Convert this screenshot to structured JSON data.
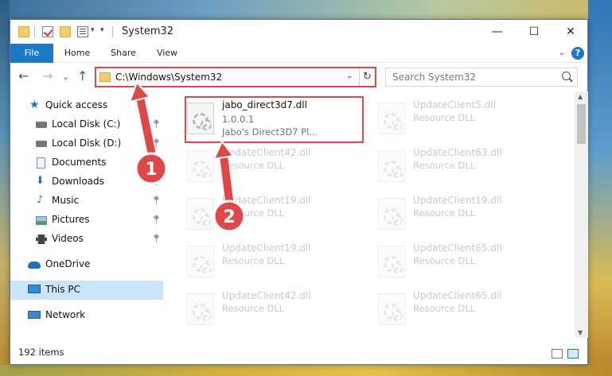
{
  "window": {
    "title": "System32",
    "controls": {
      "minimize": "—",
      "maximize": "☐",
      "close": "✕"
    }
  },
  "ribbon": {
    "tabs": [
      "File",
      "Home",
      "Share",
      "View"
    ],
    "help": "?"
  },
  "nav": {
    "back": "←",
    "forward": "→",
    "recent": "⌄",
    "up": "↑",
    "address": "C:\\Windows\\System32",
    "refresh": "↻",
    "search_placeholder": "Search System32"
  },
  "sidebar": {
    "items": [
      {
        "label": "Quick access",
        "icon": "star-icon",
        "pinned": false
      },
      {
        "label": "Local Disk (C:)",
        "icon": "drive-icon",
        "pinned": true
      },
      {
        "label": "Local Disk (D:)",
        "icon": "drive-icon",
        "pinned": true
      },
      {
        "label": "Documents",
        "icon": "documents-icon",
        "pinned": true
      },
      {
        "label": "Downloads",
        "icon": "downloads-icon",
        "pinned": true
      },
      {
        "label": "Music",
        "icon": "music-icon",
        "pinned": true
      },
      {
        "label": "Pictures",
        "icon": "pictures-icon",
        "pinned": true
      },
      {
        "label": "Videos",
        "icon": "videos-icon",
        "pinned": true
      },
      {
        "label": "OneDrive",
        "icon": "onedrive-icon",
        "pinned": false
      },
      {
        "label": "This PC",
        "icon": "computer-icon",
        "pinned": false,
        "selected": true
      },
      {
        "label": "Network",
        "icon": "network-icon",
        "pinned": false
      }
    ]
  },
  "files": [
    {
      "name": "jabo_direct3d7.dll",
      "line2": "1.0.0.1",
      "line3": "Jabo's Direct3D7 Pl...",
      "faded": false
    },
    {
      "name": "UpdateClient5.dll",
      "line2": "Resource DLL",
      "faded": true
    },
    {
      "name": "UpdateClient42.dll",
      "line2": "Resource DLL",
      "faded": true
    },
    {
      "name": "UpdateClient63.dll",
      "line2": "Resource DLL",
      "faded": true
    },
    {
      "name": "UpdateClient19.dll",
      "line2": "Resource DLL",
      "faded": true
    },
    {
      "name": "UpdateClient19.dll",
      "line2": "Resource DLL",
      "faded": true
    },
    {
      "name": "UpdateClient19.dll",
      "line2": "Resource DLL",
      "faded": true
    },
    {
      "name": "UpdateClient65.dll",
      "line2": "Resource DLL",
      "faded": true
    },
    {
      "name": "UpdateClient42.dll",
      "line2": "Resource DLL",
      "faded": true
    },
    {
      "name": "UpdateClient65.dll",
      "line2": "Resource DLL",
      "faded": true
    }
  ],
  "status": {
    "item_count": "192 items"
  },
  "annotations": {
    "step1": "1",
    "step2": "2",
    "color": "#e04848"
  },
  "colors": {
    "accent": "#1979ca",
    "selected": "#cce4f7",
    "highlight": "#e04848"
  }
}
